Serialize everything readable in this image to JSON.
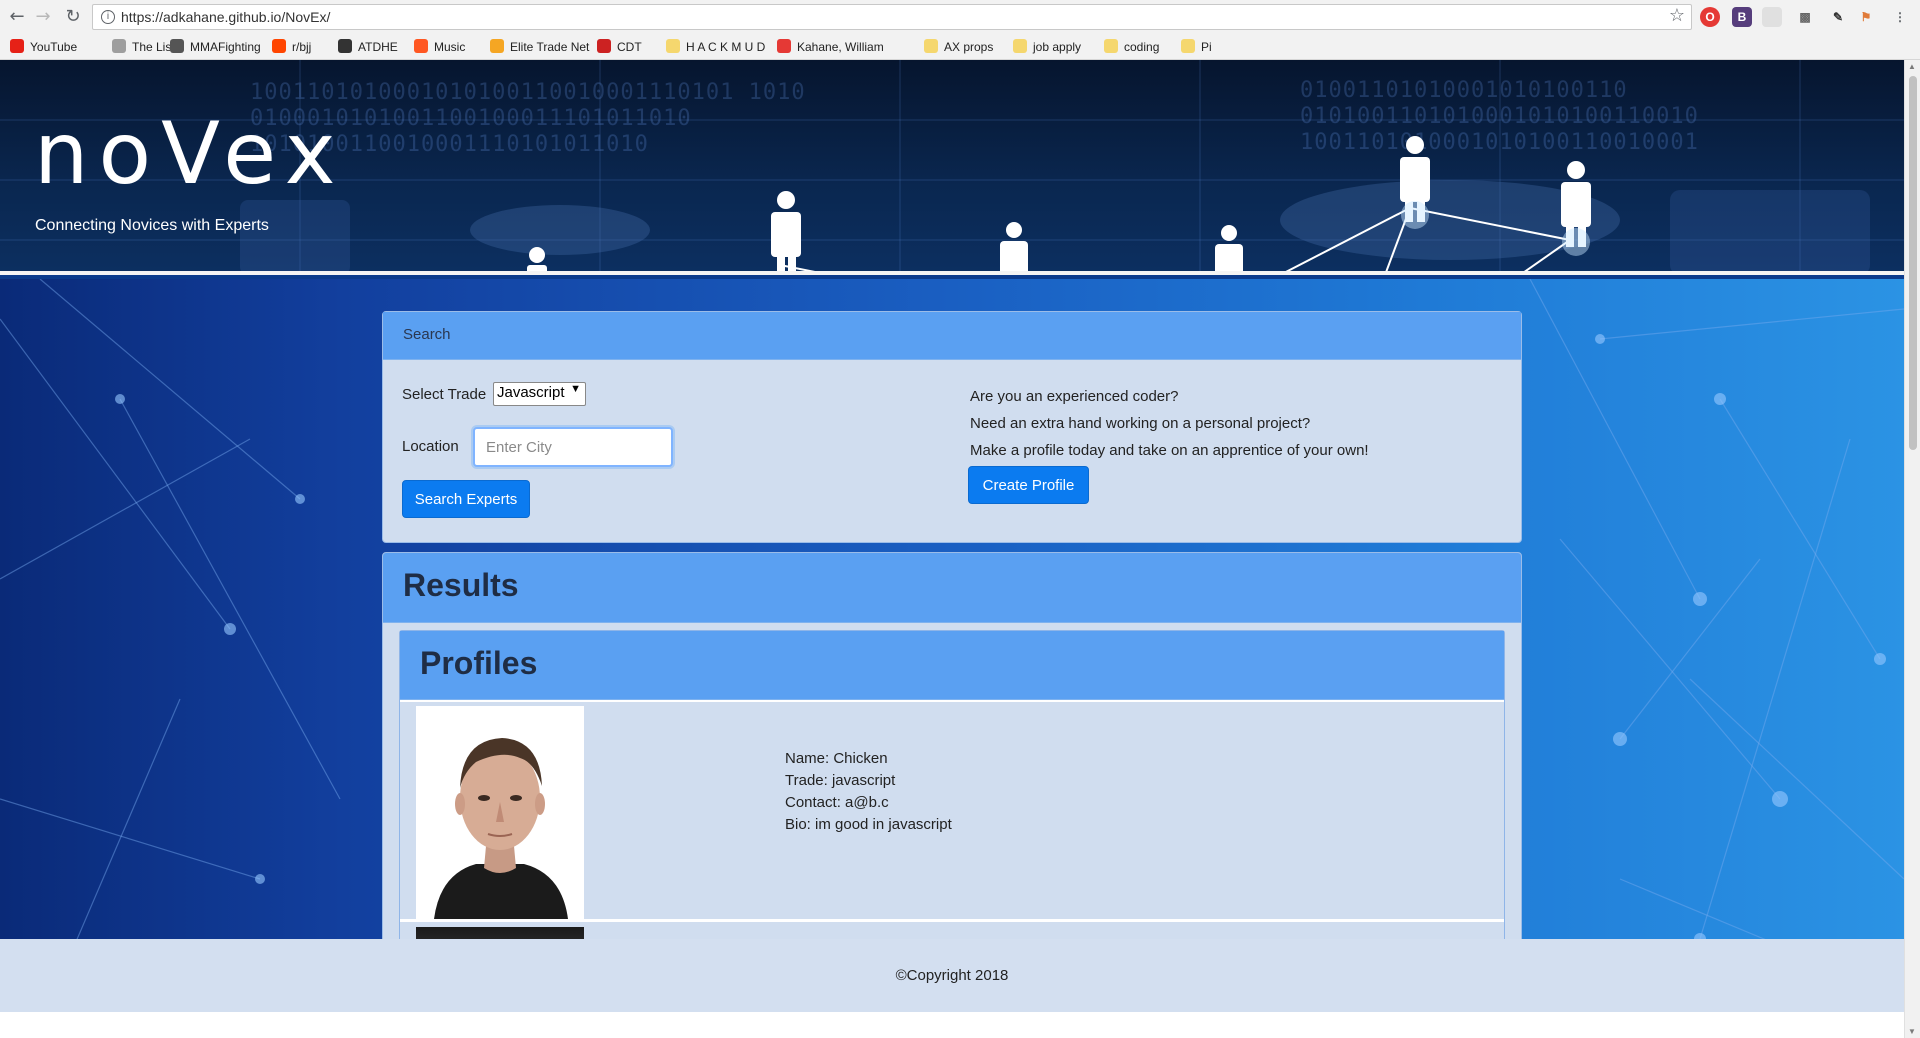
{
  "browser": {
    "url": "https://adkahane.github.io/NovEx/",
    "bookmarks": [
      {
        "label": "YouTube",
        "color": "#e62117"
      },
      {
        "label": "The List",
        "color": "#9e9e9e"
      },
      {
        "label": "MMAFighting",
        "color": "#555555"
      },
      {
        "label": "r/bjj",
        "color": "#ff4500"
      },
      {
        "label": "ATDHE",
        "color": "#333333"
      },
      {
        "label": "Music",
        "color": "#ff5722"
      },
      {
        "label": "Elite Trade Net",
        "color": "#f5a623"
      },
      {
        "label": "CDT",
        "color": "#cc2222"
      },
      {
        "label": "H A C K M U D",
        "color": "#f5d76e"
      },
      {
        "label": "Kahane, William",
        "color": "#e53935"
      },
      {
        "label": "AX props",
        "color": "#f5d76e"
      },
      {
        "label": "job apply",
        "color": "#f5d76e"
      },
      {
        "label": "coding",
        "color": "#f5d76e"
      },
      {
        "label": "Pi",
        "color": "#f5d76e"
      }
    ]
  },
  "header": {
    "logo": "noVex",
    "tagline": "Connecting Novices with Experts"
  },
  "search": {
    "title": "Search",
    "trade_label": "Select Trade",
    "trade_value": "Javascript",
    "location_label": "Location",
    "location_placeholder": "Enter City",
    "search_button": "Search Experts",
    "promo_lines": [
      "Are you an experienced coder?",
      "Need an extra hand working on a personal project?",
      "Make a profile today and take on an apprentice of your own!"
    ],
    "create_button": "Create Profile"
  },
  "results": {
    "title": "Results",
    "profiles_title": "Profiles",
    "profiles": [
      {
        "name": "Name: Chicken",
        "trade": "Trade: javascript",
        "contact": "Contact: a@b.c",
        "bio": "Bio: im good in javascript"
      }
    ]
  },
  "footer": {
    "copyright": "©Copyright 2018"
  },
  "colors": {
    "primary_button": "#0b7bf0",
    "card_header": "#5aa0f2",
    "card_body": "#d0ddef"
  }
}
